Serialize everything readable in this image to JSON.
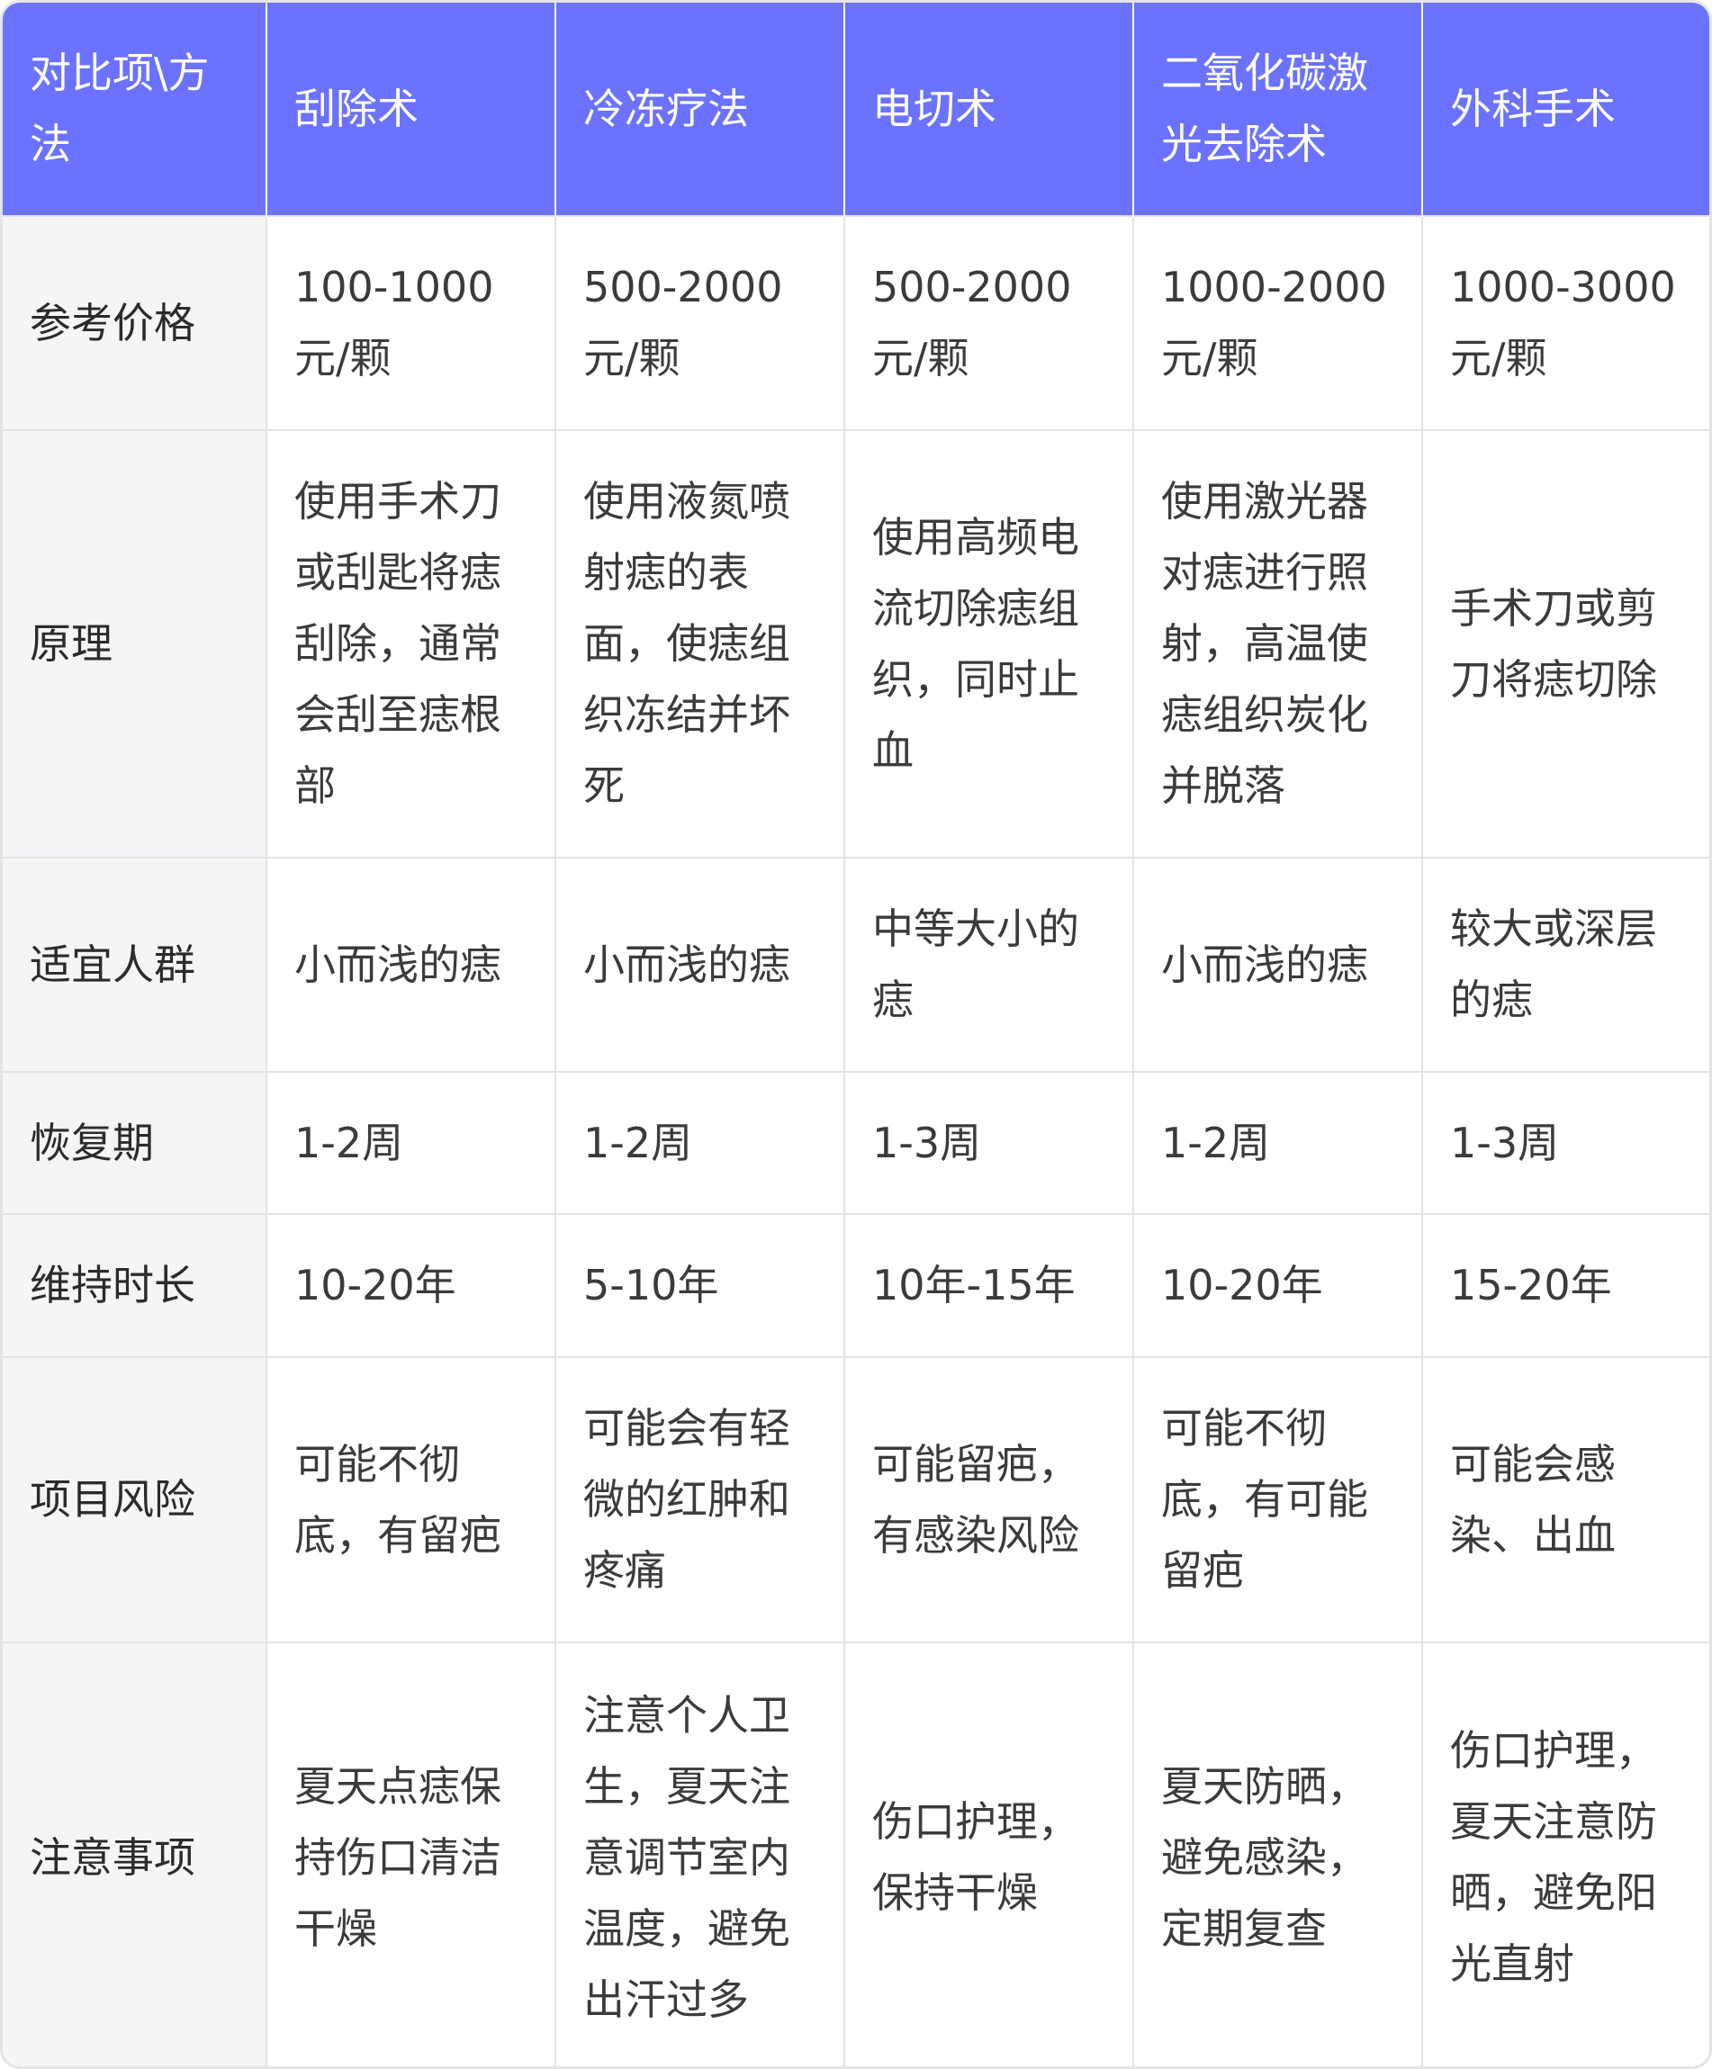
{
  "header": [
    "对比项\\方法",
    "刮除术",
    "冷冻疗法",
    "电切术",
    "二氧化碳激光去除术",
    "外科手术"
  ],
  "rows": [
    {
      "label": "参考价格",
      "cells": [
        "100-1000元/颗",
        "500-2000元/颗",
        "500-2000元/颗",
        "1000-2000元/颗",
        "1000-3000元/颗"
      ]
    },
    {
      "label": "原理",
      "cells": [
        "使用手术刀或刮匙将痣刮除，通常会刮至痣根部",
        "使用液氮喷射痣的表面，使痣组织冻结并坏死",
        "使用高频电流切除痣组织，同时止血",
        "使用激光器对痣进行照射，高温使痣组织炭化并脱落",
        "手术刀或剪刀将痣切除"
      ]
    },
    {
      "label": "适宜人群",
      "cells": [
        "小而浅的痣",
        "小而浅的痣",
        "中等大小的痣",
        "小而浅的痣",
        "较大或深层的痣"
      ]
    },
    {
      "label": "恢复期",
      "cells": [
        "1-2周",
        "1-2周",
        "1-3周",
        "1-2周",
        "1-3周"
      ]
    },
    {
      "label": "维持时长",
      "cells": [
        "10-20年",
        "5-10年",
        "10年-15年",
        "10-20年",
        "15-20年"
      ]
    },
    {
      "label": "项目风险",
      "cells": [
        "可能不彻底，有留疤",
        "可能会有轻微的红肿和疼痛",
        "可能留疤，有感染风险",
        "可能不彻底，有可能留疤",
        "可能会感染、出血"
      ]
    },
    {
      "label": "注意事项",
      "cells": [
        "夏天点痣保持伤口清洁干燥",
        "注意个人卫生，夏天注意调节室内温度，避免出汗过多",
        "伤口护理，保持干燥",
        "夏天防晒，避免感染，定期复查",
        "伤口护理，夏天注意防晒，避免阳光直射"
      ]
    }
  ],
  "colors": {
    "header_bg": "#6b72ff",
    "header_text": "#ffffff",
    "label_bg": "#f5f5f8",
    "border": "#e3e3e3"
  }
}
